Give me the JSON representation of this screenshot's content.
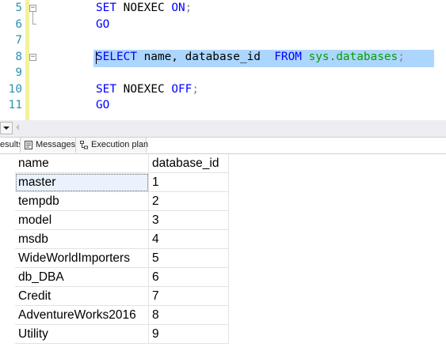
{
  "editor": {
    "lines": [
      {
        "number": "5",
        "tokens": [
          "SET",
          " NOEXEC ",
          "ON",
          ";"
        ]
      },
      {
        "number": "6",
        "tokens": [
          "GO"
        ]
      },
      {
        "number": "7",
        "tokens": []
      },
      {
        "number": "8",
        "tokens": [
          "SELECT",
          " name, database_id  ",
          "FROM",
          " ",
          "sys.databases",
          ";"
        ]
      },
      {
        "number": "9",
        "tokens": []
      },
      {
        "number": "10",
        "tokens": [
          "SET",
          " NOEXEC ",
          "OFF",
          ";"
        ]
      },
      {
        "number": "11",
        "tokens": [
          "GO"
        ]
      }
    ]
  },
  "result_tabs": {
    "results": "esults",
    "messages": "Messages",
    "execution_plan": "Execution plan"
  },
  "grid": {
    "columns": [
      "name",
      "database_id"
    ],
    "rows": [
      [
        "master",
        "1"
      ],
      [
        "tempdb",
        "2"
      ],
      [
        "model",
        "3"
      ],
      [
        "msdb",
        "4"
      ],
      [
        "WideWorldImporters",
        "5"
      ],
      [
        "db_DBA",
        "6"
      ],
      [
        "Credit",
        "7"
      ],
      [
        "AdventureWorks2016",
        "8"
      ],
      [
        "Utility",
        "9"
      ]
    ],
    "selected_cell": "master"
  },
  "icons": {
    "outline_collapse": "minus-box-icon",
    "zoom_dropdown": "chevron-down-icon",
    "scroll_left": "arrow-left-icon",
    "messages_tab": "messages-icon",
    "execution_plan_tab": "execution-plan-icon"
  },
  "colors": {
    "keyword": "#0000ff",
    "system_object": "#00a000",
    "punctuation": "#808080",
    "line_number": "#2b91af",
    "selection": "#add6ff"
  }
}
